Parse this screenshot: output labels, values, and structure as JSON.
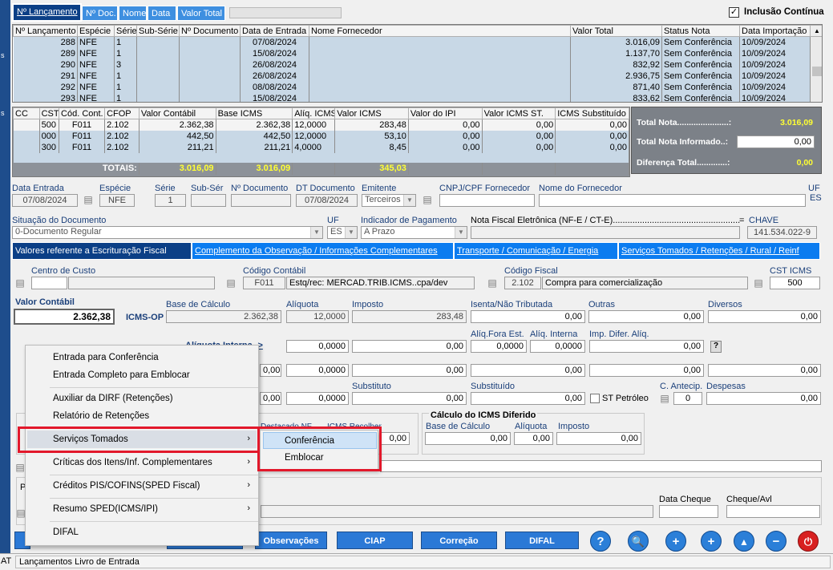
{
  "left_strip": {
    "labels": [
      "s",
      "s",
      "AT"
    ]
  },
  "top_tabs": [
    {
      "label": "Nº Lançamento",
      "active": true
    },
    {
      "label": "Nº Doc."
    },
    {
      "label": "Nome"
    },
    {
      "label": "Data"
    },
    {
      "label": "Valor Total"
    }
  ],
  "inclusao": {
    "label": "Inclusão Contínua",
    "checked": "✓"
  },
  "launch_grid": {
    "headers": [
      "Nº Lançamento",
      "Espécie",
      "Série",
      "Sub-Série",
      "Nº Documento",
      "Data de Entrada",
      "Nome Fornecedor",
      "Valor Total",
      "Status Nota",
      "Data Importação"
    ],
    "rows": [
      [
        "288",
        "NFE",
        "1",
        "",
        "",
        "07/08/2024",
        "",
        "3.016,09",
        "Sem Conferência",
        "10/09/2024"
      ],
      [
        "289",
        "NFE",
        "1",
        "",
        "",
        "15/08/2024",
        "",
        "1.137,70",
        "Sem Conferência",
        "10/09/2024"
      ],
      [
        "290",
        "NFE",
        "3",
        "",
        "",
        "26/08/2024",
        "",
        "832,92",
        "Sem Conferência",
        "10/09/2024"
      ],
      [
        "291",
        "NFE",
        "1",
        "",
        "",
        "26/08/2024",
        "",
        "2.936,75",
        "Sem Conferência",
        "10/09/2024"
      ],
      [
        "292",
        "NFE",
        "1",
        "",
        "",
        "08/08/2024",
        "",
        "871,40",
        "Sem Conferência",
        "10/09/2024"
      ],
      [
        "293",
        "NFE",
        "1",
        "",
        "",
        "15/08/2024",
        "",
        "833,62",
        "Sem Conferência",
        "10/09/2024"
      ]
    ]
  },
  "items_grid": {
    "headers": [
      "CC",
      "CST",
      "Cód. Cont.",
      "CFOP",
      "Valor Contábil",
      "Base ICMS",
      "Alíq. ICMS",
      "Valor ICMS",
      "Valor do IPI",
      "Valor ICMS ST.",
      "ICMS Substituído"
    ],
    "rows": [
      [
        "",
        "500",
        "F011",
        "2.102",
        "2.362,38",
        "2.362,38",
        "12,0000",
        "283,48",
        "0,00",
        "0,00",
        "0,00"
      ],
      [
        "",
        "000",
        "F011",
        "2.102",
        "442,50",
        "442,50",
        "12,0000",
        "53,10",
        "0,00",
        "0,00",
        "0,00"
      ],
      [
        "",
        "300",
        "F011",
        "2.102",
        "211,21",
        "211,21",
        "4,0000",
        "8,45",
        "0,00",
        "0,00",
        "0,00"
      ]
    ],
    "totals_label": "TOTAIS:",
    "totals": {
      "valor_contabil": "3.016,09",
      "base_icms": "3.016,09",
      "valor_icms": "345,03"
    }
  },
  "totals_panel": {
    "total_nota_label": "Total Nota......................:",
    "total_nota": "3.016,09",
    "informado_label": "Total Nota Informado..:",
    "informado": "0,00",
    "diferenca_label": "Diferença Total.............:",
    "diferenca": "0,00"
  },
  "doc": {
    "data_entrada_label": "Data Entrada",
    "data_entrada": "07/08/2024",
    "especie_label": "Espécie",
    "especie": "NFE",
    "serie_label": "Série",
    "serie": "1",
    "sub_serie_label": "Sub-Sér",
    "num_doc_label": "Nº Documento",
    "dt_doc_label": "DT Documento",
    "dt_doc": "07/08/2024",
    "emitente_label": "Emitente",
    "emitente": "Terceiros",
    "cnpj_label": "CNPJ/CPF Fornecedor",
    "nome_label": "Nome do Fornecedor",
    "uf_label": "UF",
    "uf_value": "ES",
    "situacao_label": "Situação do Documento",
    "situacao": "0-Documento Regular",
    "uf2_label": "UF",
    "uf2": "ES",
    "pagamento_label": "Indicador de Pagamento",
    "pagamento": "A Prazo",
    "nfe_label": "Nota Fiscal Eletrônica (NF-E / CT-E)....................................................",
    "chave_eq": "=",
    "chave_label": "CHAVE",
    "chave": "141.534.022-9"
  },
  "section_tabs": [
    {
      "label": "Valores referente a Escrituração Fiscal",
      "active": true
    },
    {
      "label": "Complemento da Observação / Informações Complementares"
    },
    {
      "label": "Transporte / Comunicação / Energia"
    },
    {
      "label": "Serviços Tomados / Retenções / Rural / Reinf"
    }
  ],
  "fiscal": {
    "centro_custo_label": "Centro de Custo",
    "codigo_contabil_label": "Código Contábil",
    "codigo_contabil": "F011",
    "codigo_contabil_desc": "Estq/rec: MERCAD.TRIB.ICMS..cpa/dev",
    "codigo_fiscal_label": "Código Fiscal",
    "codigo_fiscal": "2.102",
    "codigo_fiscal_desc": "Compra para comercialização",
    "cst_label": "CST ICMS",
    "cst": "500",
    "valor_contabil_label": "Valor Contábil",
    "valor_contabil": "2.362,38",
    "icms_op_label": "ICMS-OP",
    "base_label": "Base de Cálculo",
    "base": "2.362,38",
    "aliquota_label": "Alíquota",
    "aliquota": "12,0000",
    "imposto_label": "Imposto",
    "imposto": "283,48",
    "isenta_label": "Isenta/Não Tributada",
    "isenta": "0,00",
    "outras_label": "Outras",
    "outras": "0,00",
    "diversos_label": "Diversos",
    "diversos": "0,00",
    "aliq_interna_label": "Alíquota Interna ->",
    "aliq_fora_label": "Alíq.Fora Est.",
    "aliq_fora": "0,0000",
    "aliq_int2_label": "Alíq. Interna",
    "aliq_int2": "0,0000",
    "imp_difer_label": "Imp. Difer. Alíq.",
    "imp_difer": "0,00",
    "help": "?",
    "row2": [
      "0,00",
      "0,0000",
      "0,00",
      "0,00",
      "0,00",
      "0,00"
    ],
    "substituto_label": "Substituto",
    "substituto": "0,00",
    "substituido_label": "Substituído",
    "substituido": "0,00",
    "st_petroleo_label": "ST Petróleo",
    "c_antecip_label": "C. Antecip.",
    "c_antecip": "0",
    "despesas_label": "Despesas",
    "despesas": "0,00",
    "row3": [
      "0,00",
      "0,0000"
    ],
    "partial_label_1": "Destacado NF",
    "partial_label_2": "ICMS Recolher",
    "partial_val": "0,00",
    "dif_title": "Cálculo do ICMS Diferido",
    "dif_base_label": "Base de Cálculo",
    "dif_base": "0,00",
    "dif_aliq_label": "Alíquota",
    "dif_aliq": "0,00",
    "dif_imp_label": "Imposto",
    "dif_imp": "0,00",
    "p_label": "P",
    "data_cheque_label": "Data Cheque",
    "cheque_label": "Cheque/Avl"
  },
  "context_menu": {
    "items": [
      {
        "label": "Entrada para Conferência"
      },
      {
        "label": "Entrada Completo para Emblocar"
      },
      {
        "label": "Auxiliar da DIRF (Retenções)"
      },
      {
        "label": "Relatório de Retenções"
      },
      {
        "label": "Serviços Tomados",
        "submenu": true
      },
      {
        "label": "Críticas dos Itens/Inf. Complementares",
        "submenu": true
      },
      {
        "label": "Créditos PIS/COFINS(SPED Fiscal)",
        "submenu": true
      },
      {
        "label": "Resumo SPED(ICMS/IPI)",
        "submenu": true
      },
      {
        "label": "DIFAL"
      }
    ],
    "arrow": "›"
  },
  "submenu": {
    "items": [
      "Conferência",
      "Emblocar"
    ]
  },
  "bottom_buttons": [
    "Observações",
    "CIAP",
    "Correção",
    "DIFAL"
  ],
  "round_buttons": [
    "?",
    "🔍",
    "+",
    "+",
    "▲",
    "−",
    "⏻"
  ],
  "status_bar": {
    "text": "Lançamentos Livro de Entrada"
  },
  "colors": {
    "accent": "#0b7cf0",
    "dark_tab": "#0b3f86",
    "highlight_red": "#e2182b",
    "total_yellow": "#ffff33"
  }
}
